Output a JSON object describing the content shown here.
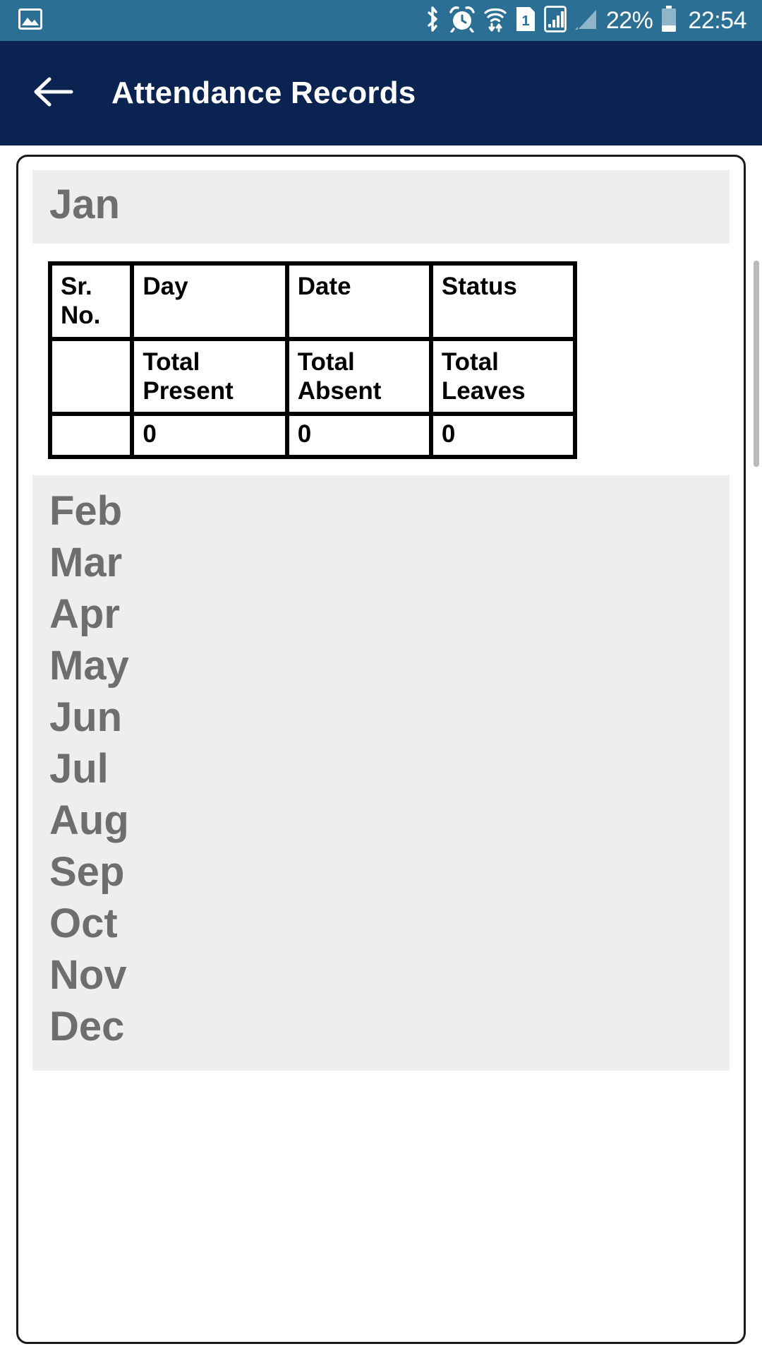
{
  "status_bar": {
    "background_color": "#2b7094",
    "left_icons": [
      {
        "name": "image-icon",
        "glyph": "picture"
      }
    ],
    "right_icons": [
      {
        "name": "bluetooth-icon"
      },
      {
        "name": "alarm-clock-icon"
      },
      {
        "name": "wifi-transfer-icon"
      },
      {
        "name": "sim-card-1-icon",
        "label": "1"
      },
      {
        "name": "signal-boxed-icon"
      },
      {
        "name": "signal-triangle-icon"
      }
    ],
    "battery_percent": "22%",
    "clock": "22:54"
  },
  "app_bar": {
    "background_color": "#0a2351",
    "back_label": "Back",
    "title": "Attendance Records"
  },
  "card": {
    "selected_month": "Jan",
    "table": {
      "header": {
        "sr_no": "Sr. No.",
        "day": "Day",
        "date": "Date",
        "status": "Status"
      },
      "totals_header": {
        "sr_no": "",
        "present": "Total Present",
        "absent": "Total Absent",
        "leaves": "Total Leaves"
      },
      "totals_values": {
        "sr_no": "",
        "present": "0",
        "absent": "0",
        "leaves": "0"
      }
    },
    "months": [
      {
        "label": "Feb"
      },
      {
        "label": "Mar"
      },
      {
        "label": "Apr"
      },
      {
        "label": "May"
      },
      {
        "label": "Jun"
      },
      {
        "label": "Jul"
      },
      {
        "label": "Aug"
      },
      {
        "label": "Sep"
      },
      {
        "label": "Oct"
      },
      {
        "label": "Nov"
      },
      {
        "label": "Dec"
      }
    ]
  },
  "colors": {
    "status_bar": "#2b7094",
    "app_bar": "#0a2351",
    "month_band": "#eeeeee",
    "month_text": "#6e6e6e",
    "card_border": "#1a1a1a",
    "table_border": "#000000"
  }
}
